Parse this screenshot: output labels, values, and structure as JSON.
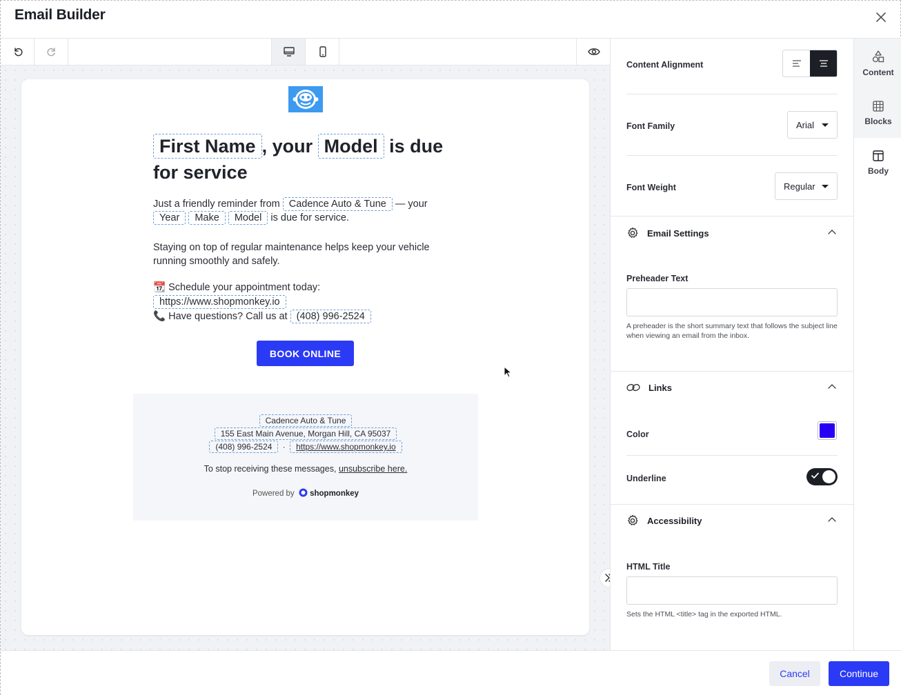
{
  "app": {
    "title": "Email Builder"
  },
  "email": {
    "headline": {
      "first_name": "First Name",
      "joiner1": ", your",
      "model": "Model",
      "joiner2": "is due",
      "line2": "for service"
    },
    "reminder": {
      "pre": "Just a friendly reminder from",
      "shop": "Cadence Auto & Tune",
      "mid": "— your",
      "year": "Year",
      "make": "Make",
      "model": "Model",
      "post": "is due for service."
    },
    "maintenance": "Staying on top of regular maintenance helps keep your vehicle running smoothly and safely.",
    "schedule": {
      "emoji": "📆",
      "text": "Schedule your appointment today:",
      "url": "https://www.shopmonkey.io",
      "phone_emoji": "📞",
      "phone_text": "Have questions? Call us at",
      "phone": "(408) 996-2524"
    },
    "cta": "BOOK ONLINE",
    "footer": {
      "shop": "Cadence Auto & Tune",
      "address": "155 East Main Avenue, Morgan Hill, CA 95037",
      "phone": "(408) 996-2524",
      "dot": "·",
      "url": "https://www.shopmonkey.io",
      "unsubscribe_pre": "To stop receiving these messages,",
      "unsubscribe_link": "unsubscribe here.",
      "powered_by": "Powered by",
      "brand": "shopmonkey"
    }
  },
  "panel": {
    "content_alignment": "Content Alignment",
    "font_family_label": "Font Family",
    "font_family_value": "Arial",
    "font_weight_label": "Font Weight",
    "font_weight_value": "Regular",
    "email_settings": {
      "title": "Email Settings",
      "preheader_label": "Preheader Text",
      "preheader_value": "",
      "preheader_help": "A preheader is the short summary text that follows the subject line when viewing an email from the inbox."
    },
    "links": {
      "title": "Links",
      "color_label": "Color",
      "color_value": "#2a00f5",
      "underline_label": "Underline",
      "underline_on": true
    },
    "accessibility": {
      "title": "Accessibility",
      "html_title_label": "HTML Title",
      "html_title_value": "",
      "html_title_help": "Sets the HTML <title> tag in the exported HTML."
    }
  },
  "tabs": [
    {
      "label": "Content",
      "icon": "shapes-icon"
    },
    {
      "label": "Blocks",
      "icon": "grid-icon"
    },
    {
      "label": "Body",
      "icon": "layout-icon"
    }
  ],
  "footer_buttons": {
    "cancel": "Cancel",
    "continue": "Continue"
  },
  "colors": {
    "accent": "#2b3af5",
    "logo_bg": "#3c9af0",
    "dark": "#1c1f26"
  }
}
